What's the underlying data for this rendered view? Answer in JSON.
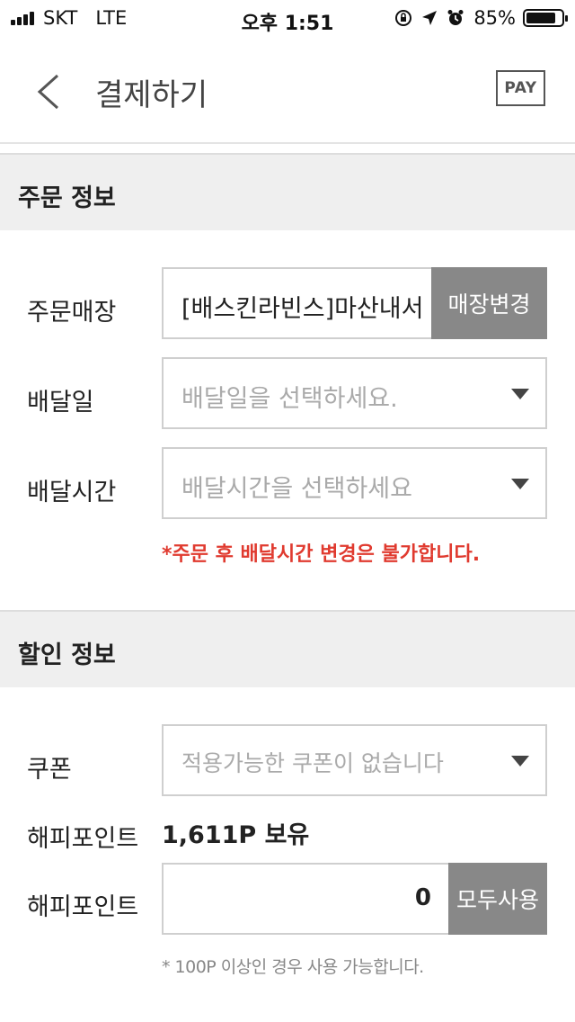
{
  "status_bar": {
    "carrier": "SKT",
    "network": "LTE",
    "time": "오후 1:51",
    "battery_percent": "85%",
    "battery_level": 0.85,
    "icons": [
      "signal-icon",
      "orientation-lock-icon",
      "location-icon",
      "alarm-icon",
      "battery-icon"
    ]
  },
  "header": {
    "title": "결제하기",
    "pay_label": "PAY"
  },
  "order_info": {
    "section_title": "주문 정보",
    "store_label": "주문매장",
    "store_value": "[배스킨라빈스]마산내서",
    "change_store_label": "매장변경",
    "delivery_date_label": "배달일",
    "delivery_date_placeholder": "배달일을 선택하세요.",
    "delivery_time_label": "배달시간",
    "delivery_time_placeholder": "배달시간을 선택하세요",
    "warning": "*주문 후 배달시간 변경은 불가합니다."
  },
  "discount_info": {
    "section_title": "할인 정보",
    "coupon_label": "쿠폰",
    "coupon_placeholder": "적용가능한 쿠폰이 없습니다",
    "happy_point_label": "해피포인트",
    "happy_point_balance": "1,611P 보유",
    "happy_point_input_label": "해피포인트",
    "happy_point_value": "0",
    "use_all_label": "모두사용",
    "note": "* 100P 이상인 경우 사용 가능합니다."
  },
  "colors": {
    "accent_warning": "#e03a2f",
    "button_gray": "#888888",
    "section_bg": "#efefef"
  }
}
